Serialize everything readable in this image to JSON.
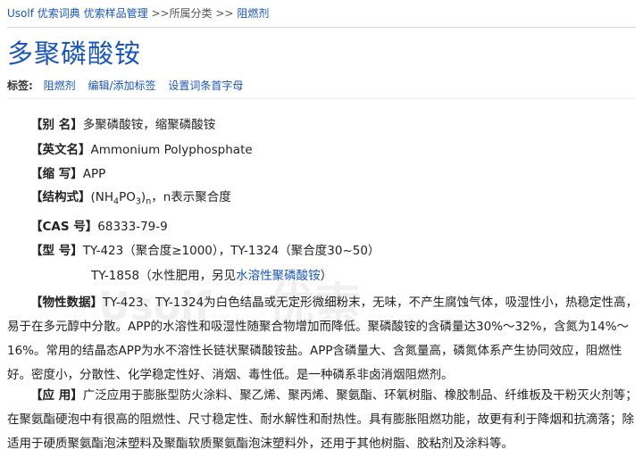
{
  "breadcrumb": {
    "site": "Usolf 优索词典",
    "section": "优索样品管理",
    "sep1": ">>",
    "category": "所属分类",
    "sep2": ">>",
    "current": "阻燃剂"
  },
  "title": "多聚磷酸铵",
  "tags": {
    "label": "标签:",
    "items": [
      "阻燃剂",
      "编辑/添加标签",
      "设置词条首字母"
    ]
  },
  "fields": {
    "alias": {
      "label": "【别  名】",
      "value": "多聚磷酸铵，缩聚磷酸铵"
    },
    "english": {
      "label": "【英文名】",
      "value": "Ammonium Polyphosphate"
    },
    "abbr": {
      "label": "【缩  写】",
      "value": "APP"
    },
    "formula": {
      "label": "【结构式】",
      "open": "(NH",
      "sub1": "4",
      "mid": "PO",
      "sub2": "3",
      "close": ")",
      "subn": "n",
      "note": "，n表示聚合度"
    },
    "cas": {
      "label": "【CAS 号】",
      "value": "68333-79-9"
    },
    "model": {
      "label": "【型  号】",
      "line1": "TY-423（聚合度≥1000），TY-1324（聚合度30~50）",
      "line2_prefix": "TY-1858（水性肥用，另见",
      "line2_link": "水溶性聚磷酸铵",
      "line2_suffix": "）"
    }
  },
  "properties": {
    "label": "【物性数据】",
    "text": "TY-423、TY-1324为白色结晶或无定形微细粉末，无味，不产生腐蚀气体，吸湿性小，热稳定性高，易于在多元醇中分散。APP的水溶性和吸湿性随聚合物增加而降低。聚磷酸铵的含磷量达30%～32%，含氮为14%～16%。常用的结晶态APP为水不溶性长链状聚磷酸铵盐。APP含磷量大、含氮量高，磷氮体系产生协同效应，阻燃性好。密度小，分散性、化学稳定性好、消烟、毒性低。是一种磷系非卤消烟阻燃剂。"
  },
  "application": {
    "label": "【应  用】",
    "text": "广泛应用于膨胀型防火涂料、聚乙烯、聚丙烯、聚氨酯、环氧树脂、橡胶制品、纤维板及干粉灭火剂等；在聚氨酯硬泡中有很高的阻燃性、尺寸稳定性、耐水解性和耐热性。具有膨胀阻燃功能，故更有利于降烟和抗滴落；除适用于硬质聚氨酯泡沫塑料及聚酯软质聚氨酯泡沫塑料外，还用于其他树脂、胶粘剂及涂料等。"
  },
  "watermarks": [
    "Usolf",
    "优索"
  ],
  "colors": {
    "link": "#1a56b8",
    "title": "#1a56b8",
    "text": "#222222"
  }
}
